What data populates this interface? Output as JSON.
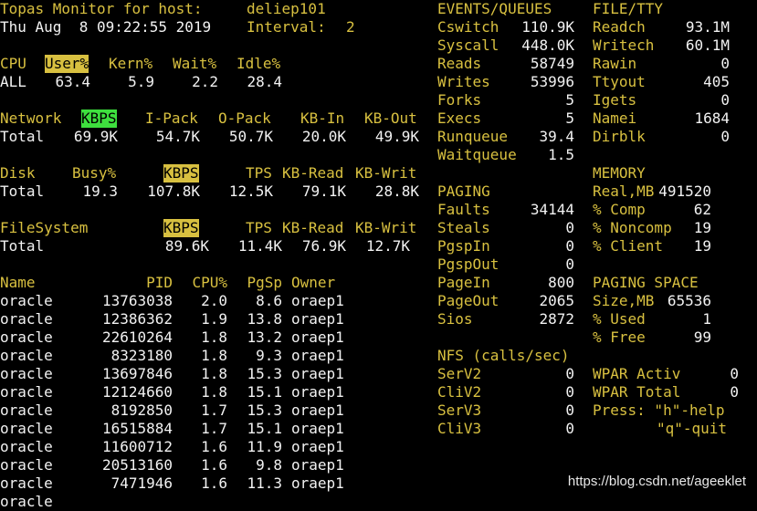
{
  "header": {
    "title": "Topas Monitor for host:",
    "host": "deliep101",
    "datetime": "Thu Aug  8 09:22:55 2019",
    "interval_label": "Interval:",
    "interval_value": "2"
  },
  "cpu": {
    "headers": [
      "CPU",
      "User%",
      "Kern%",
      "Wait%",
      "Idle%"
    ],
    "row": [
      "ALL",
      "63.4",
      "5.9",
      "2.2",
      "28.4"
    ]
  },
  "network": {
    "headers": [
      "Network",
      "KBPS",
      "I-Pack",
      "O-Pack",
      "KB-In",
      "KB-Out"
    ],
    "row": [
      "Total",
      "69.9K",
      "54.7K",
      "50.7K",
      "20.0K",
      "49.9K"
    ]
  },
  "disk": {
    "headers": [
      "Disk",
      "Busy%",
      "KBPS",
      "TPS",
      "KB-Read",
      "KB-Writ"
    ],
    "row": [
      "Total",
      "19.3",
      "107.8K",
      "12.5K",
      "79.1K",
      "28.8K"
    ]
  },
  "filesystem": {
    "headers": [
      "FileSystem",
      "KBPS",
      "TPS",
      "KB-Read",
      "KB-Writ"
    ],
    "row": [
      "Total",
      "89.6K",
      "11.4K",
      "76.9K",
      "12.7K"
    ]
  },
  "processes": {
    "headers": [
      "Name",
      "PID",
      "CPU%",
      "PgSp",
      "Owner"
    ],
    "rows": [
      [
        "oracle",
        "13763038",
        "2.0",
        "8.6",
        "oraep1"
      ],
      [
        "oracle",
        "12386362",
        "1.9",
        "13.8",
        "oraep1"
      ],
      [
        "oracle",
        "22610264",
        "1.8",
        "13.2",
        "oraep1"
      ],
      [
        "oracle",
        "8323180",
        "1.8",
        "9.3",
        "oraep1"
      ],
      [
        "oracle",
        "13697846",
        "1.8",
        "15.3",
        "oraep1"
      ],
      [
        "oracle",
        "12124660",
        "1.8",
        "15.1",
        "oraep1"
      ],
      [
        "oracle",
        "8192850",
        "1.7",
        "15.3",
        "oraep1"
      ],
      [
        "oracle",
        "16515884",
        "1.7",
        "15.1",
        "oraep1"
      ],
      [
        "oracle",
        "11600712",
        "1.6",
        "11.9",
        "oraep1"
      ],
      [
        "oracle",
        "20513160",
        "1.6",
        "9.8",
        "oraep1"
      ],
      [
        "oracle",
        "7471946",
        "1.6",
        "11.3",
        "oraep1"
      ]
    ]
  },
  "events": {
    "title": "EVENTS/QUEUES",
    "items": [
      {
        "label": "Cswitch",
        "value": "110.9K"
      },
      {
        "label": "Syscall",
        "value": "448.0K"
      },
      {
        "label": "Reads",
        "value": "58749"
      },
      {
        "label": "Writes",
        "value": "53996"
      },
      {
        "label": "Forks",
        "value": "5"
      },
      {
        "label": "Execs",
        "value": "5"
      },
      {
        "label": "Runqueue",
        "value": "39.4"
      },
      {
        "label": "Waitqueue",
        "value": "1.5"
      }
    ]
  },
  "filetty": {
    "title": "FILE/TTY",
    "items": [
      {
        "label": "Readch",
        "value": "93.1M"
      },
      {
        "label": "Writech",
        "value": "60.1M"
      },
      {
        "label": "Rawin",
        "value": "0"
      },
      {
        "label": "Ttyout",
        "value": "405"
      },
      {
        "label": "Igets",
        "value": "0"
      },
      {
        "label": "Namei",
        "value": "1684"
      },
      {
        "label": "Dirblk",
        "value": "0"
      }
    ]
  },
  "paging": {
    "title": "PAGING",
    "items": [
      {
        "label": "Faults",
        "value": "34144"
      },
      {
        "label": "Steals",
        "value": "0"
      },
      {
        "label": "PgspIn",
        "value": "0"
      },
      {
        "label": "PgspOut",
        "value": "0"
      },
      {
        "label": "PageIn",
        "value": "800"
      },
      {
        "label": "PageOut",
        "value": "2065"
      },
      {
        "label": "Sios",
        "value": "2872"
      }
    ]
  },
  "memory": {
    "title": "MEMORY",
    "items": [
      {
        "label": "Real,MB",
        "value": "491520"
      },
      {
        "label": "% Comp",
        "value": "62"
      },
      {
        "label": "% Noncomp",
        "value": "19"
      },
      {
        "label": "% Client",
        "value": "19"
      }
    ]
  },
  "paging_space": {
    "title": "PAGING SPACE",
    "items": [
      {
        "label": "Size,MB",
        "value": "65536"
      },
      {
        "label": "% Used",
        "value": "1"
      },
      {
        "label": "% Free",
        "value": "99"
      }
    ]
  },
  "nfs": {
    "title": "NFS (calls/sec)",
    "items": [
      {
        "label": "SerV2",
        "value": "0"
      },
      {
        "label": "CliV2",
        "value": "0"
      },
      {
        "label": "SerV3",
        "value": "0"
      },
      {
        "label": "CliV3",
        "value": "0"
      }
    ]
  },
  "wpar": {
    "items": [
      {
        "label": "WPAR Activ",
        "value": "0"
      },
      {
        "label": "WPAR Total",
        "value": "0"
      }
    ],
    "help1": "Press: \"h\"-help",
    "help2": "\"q\"-quit"
  },
  "watermark": "https://blog.csdn.net/ageeklet",
  "colors": {
    "bg": "#000000",
    "label": "#d8c040",
    "value": "#f2f2f2",
    "highlight": "#d8c040",
    "highlight_green": "#3ee03e"
  }
}
